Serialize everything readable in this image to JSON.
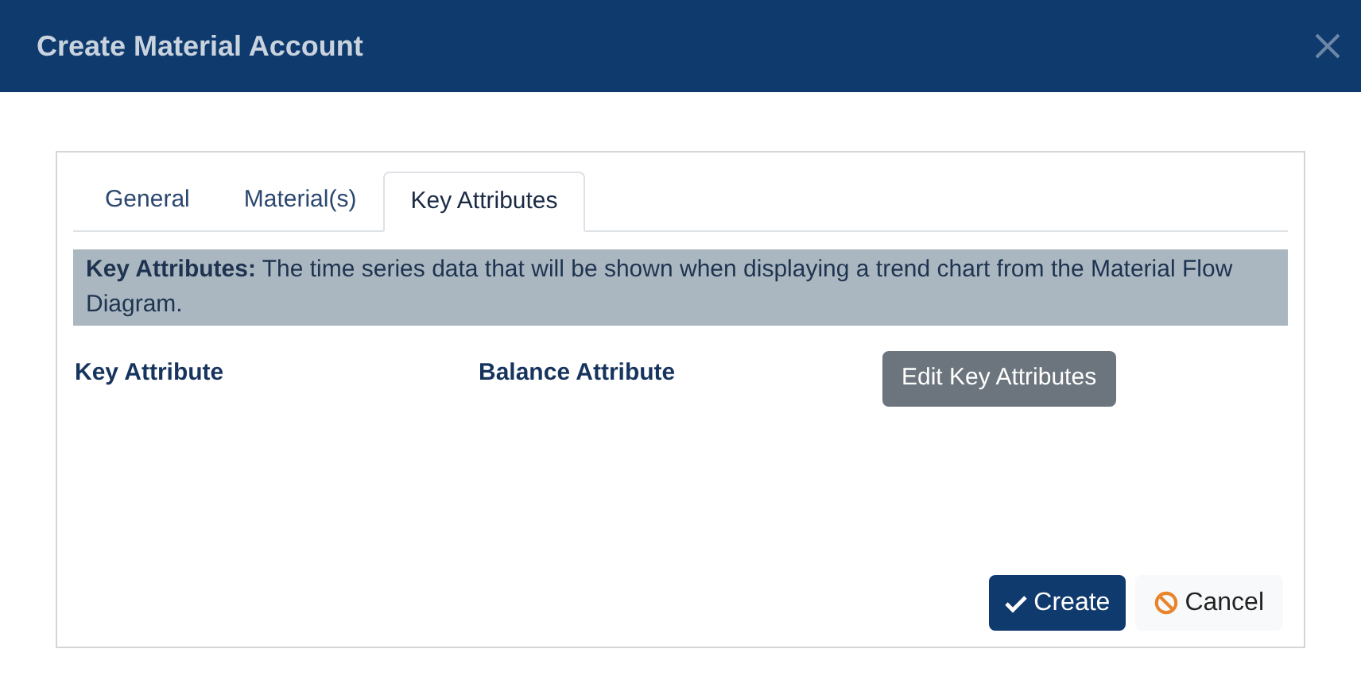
{
  "window": {
    "title": "Create Material Account"
  },
  "tabs": [
    {
      "label": "General",
      "selected": false
    },
    {
      "label": "Material(s)",
      "selected": false
    },
    {
      "label": "Key Attributes",
      "selected": true
    }
  ],
  "info": {
    "text": "**Key Attributes:** The time series data that will be shown when displaying a trend chart from the Material Flow Diagram."
  },
  "columns": [
    "Key Attribute",
    "Balance Attribute"
  ],
  "edit_button": "Edit Key Attributes",
  "buttons": [
    {
      "kind": "primary",
      "label": "Create"
    },
    {
      "kind": "cancel",
      "label": "Cancel"
    }
  ]
}
